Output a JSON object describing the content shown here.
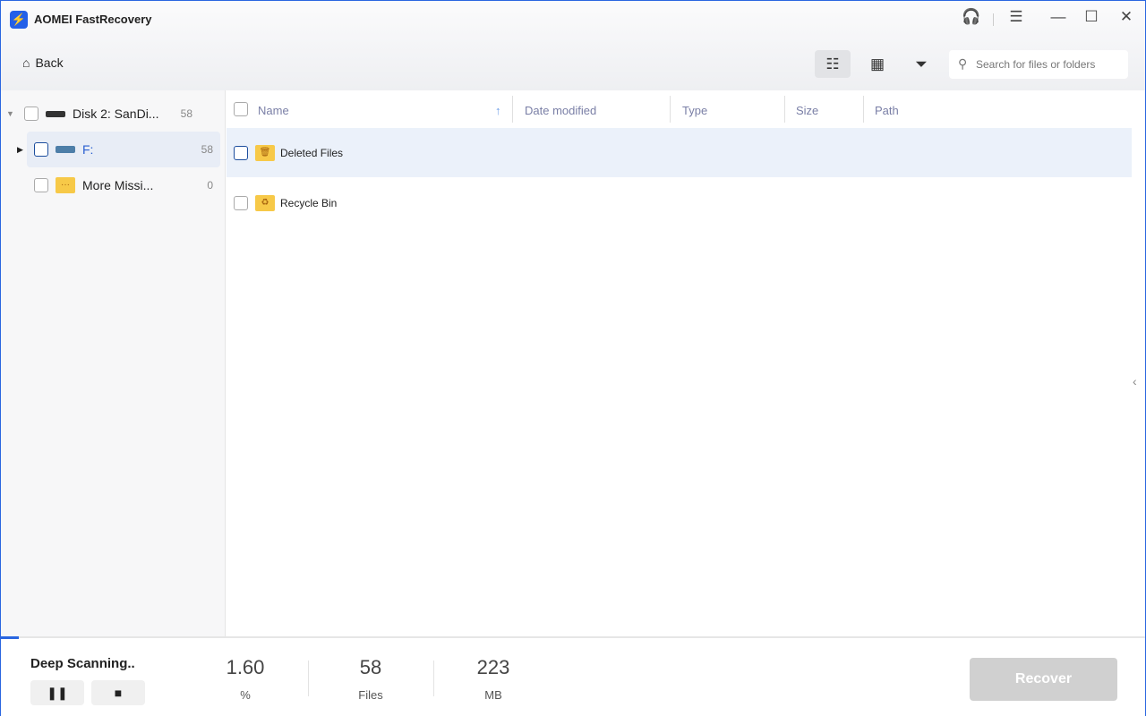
{
  "app": {
    "title": "AOMEI FastRecovery"
  },
  "toolbar": {
    "back_label": "Back",
    "search_placeholder": "Search for files or folders"
  },
  "tree": [
    {
      "label": "Disk 2: SanDi...",
      "count": "58"
    },
    {
      "label": "F:",
      "count": "58"
    },
    {
      "label": "More Missi...",
      "count": "0"
    }
  ],
  "columns": [
    "Name",
    "Date modified",
    "Type",
    "Size",
    "Path"
  ],
  "files": [
    {
      "name": "Deleted Files"
    },
    {
      "name": "Recycle Bin"
    }
  ],
  "status": {
    "label": "Deep Scanning..",
    "percent": "1.60",
    "percent_unit": "%",
    "files": "58",
    "files_unit": "Files",
    "size": "223",
    "size_unit": "MB",
    "progress_fraction": 0.016,
    "recover_label": "Recover"
  }
}
